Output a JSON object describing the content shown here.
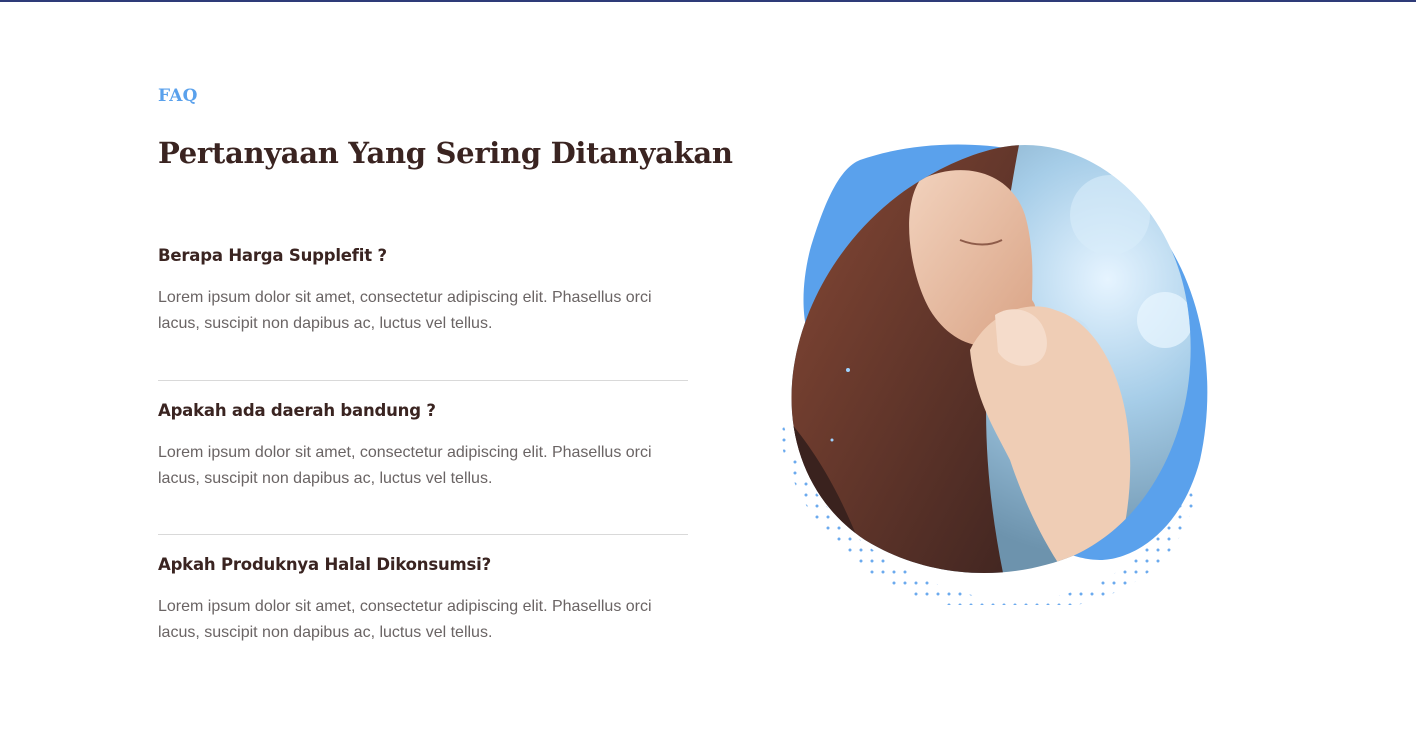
{
  "section": {
    "eyebrow": "FAQ",
    "title": "Pertanyaan Yang Sering Ditanyakan"
  },
  "faq_items": [
    {
      "question": "Berapa Harga Supplefit ?",
      "answer": "Lorem ipsum dolor sit amet, consectetur adipiscing elit. Phasellus orci lacus, suscipit non dapibus ac, luctus vel tellus."
    },
    {
      "question": "Apakah ada daerah bandung ?",
      "answer": "Lorem ipsum dolor sit amet, consectetur adipiscing elit. Phasellus orci lacus, suscipit non dapibus ac, luctus vel tellus."
    },
    {
      "question": "Apkah Produknya Halal Dikonsumsi?",
      "answer": "Lorem ipsum dolor sit amet, consectetur adipiscing elit. Phasellus orci lacus, suscipit non dapibus ac, luctus vel tellus."
    }
  ],
  "colors": {
    "accent": "#5aa1ec",
    "heading": "#3a2421",
    "body_text": "#6a6464",
    "divider": "#d9d9d9",
    "top_rule": "#2e3b78"
  },
  "illustration": {
    "icon": "praying-woman-photo"
  }
}
